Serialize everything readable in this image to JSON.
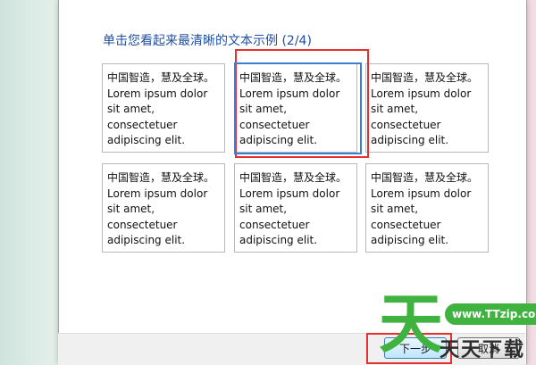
{
  "dialog": {
    "title": "单击您看起来最清晰的文本示例 (2/4)"
  },
  "samples": [
    {
      "lines": [
        "中国智造，慧及全球。",
        "Lorem ipsum dolor",
        "sit amet,",
        "consectetuer",
        "adipiscing elit."
      ]
    },
    {
      "lines": [
        "中国智造，慧及全球。",
        "Lorem ipsum dolor",
        "sit amet,",
        "consectetuer",
        "adipiscing elit."
      ]
    },
    {
      "lines": [
        "中国智造，慧及全球。",
        "Lorem ipsum dolor",
        "sit amet,",
        "consectetuer",
        "adipiscing elit."
      ]
    },
    {
      "lines": [
        "中国智造，慧及全球。",
        "Lorem ipsum dolor",
        "sit amet,",
        "consectetuer",
        "adipiscing elit."
      ]
    },
    {
      "lines": [
        "中国智造，慧及全球。",
        "Lorem ipsum dolor",
        "sit amet,",
        "consectetuer",
        "adipiscing elit."
      ]
    },
    {
      "lines": [
        "中国智造，慧及全球。",
        "Lorem ipsum dolor",
        "sit amet,",
        "consectetuer",
        "adipiscing elit."
      ]
    }
  ],
  "footer": {
    "next_label": "下一步",
    "cancel_label": "取消"
  },
  "watermark": {
    "glyph": "天",
    "url": "www.TTzip.com",
    "text": "天天下载"
  },
  "colors": {
    "title": "#1f4fa3",
    "highlight_red": "#e53030",
    "highlight_blue": "#3b7ed2",
    "watermark_green": "#3fb23f"
  }
}
